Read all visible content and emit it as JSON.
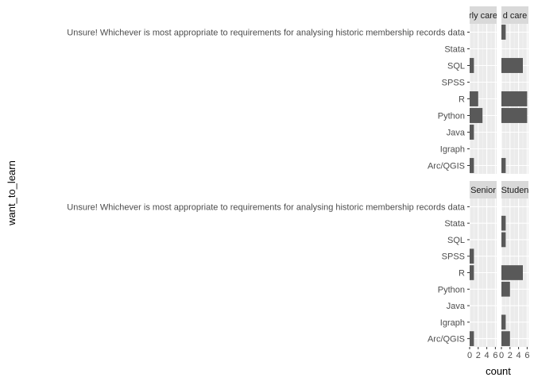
{
  "chart_data": {
    "type": "bar",
    "orientation": "horizontal",
    "faceted": true,
    "xlabel": "count",
    "ylabel": "want_to_learn",
    "xlim": [
      0,
      6.3
    ],
    "xticks": [
      0,
      2,
      4,
      6
    ],
    "grid": true,
    "categories": [
      "Unsure! Whichever is most appropriate to requirements for analysing historic membership records data",
      "Stata",
      "SQL",
      "SPSS",
      "R",
      "Python",
      "Java",
      "Igraph",
      "Arc/QGIS"
    ],
    "panels": [
      {
        "strip": "rly care",
        "values": [
          0,
          0,
          1,
          0,
          2,
          3,
          1,
          0,
          1
        ]
      },
      {
        "strip": "d care",
        "values": [
          1,
          0,
          5,
          0,
          6,
          6,
          0,
          0,
          1
        ]
      },
      {
        "strip": "Senior",
        "values": [
          0,
          0,
          0,
          1,
          1,
          0,
          0,
          0,
          1
        ]
      },
      {
        "strip": "Studen",
        "values": [
          0,
          1,
          1,
          0,
          5,
          2,
          0,
          1,
          2
        ]
      }
    ]
  }
}
